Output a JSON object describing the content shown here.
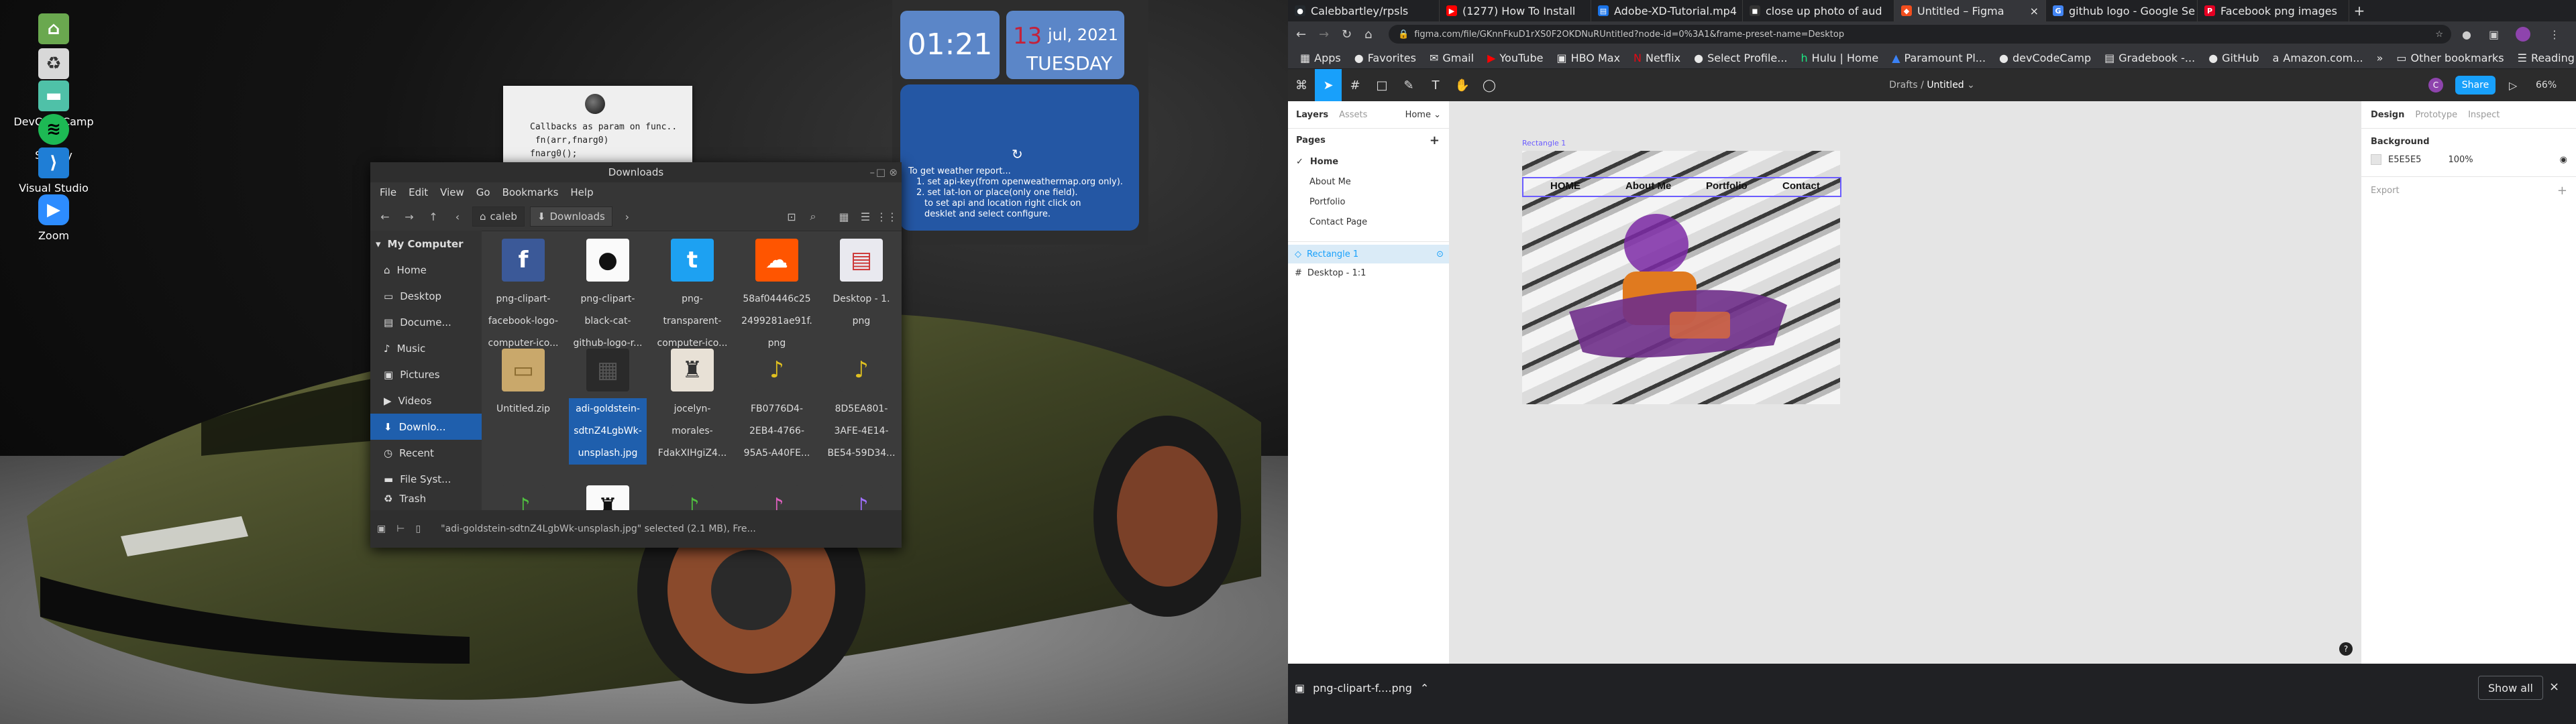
{
  "desktop": {
    "icons": [
      {
        "label": "Home",
        "color": "#6aa84f",
        "glyph": "⌂"
      },
      {
        "label": "Trash",
        "color": "#d8d8d8",
        "glyph": "♻"
      },
      {
        "label": "DevCodeCamp",
        "color": "#4fc1a8",
        "glyph": "▬"
      },
      {
        "label": "Spotify",
        "color": "#1db954",
        "glyph": "≋"
      },
      {
        "label": "Visual Studio Code",
        "color": "#1f7ed6",
        "glyph": "⟩"
      },
      {
        "label": "Zoom",
        "color": "#2d8cff",
        "glyph": "▶"
      }
    ],
    "sticky_note": "Callbacks as param on func..\n fn(arr,fnarg0)\nfnarg0();"
  },
  "clock": {
    "time": "01:21",
    "day": "13",
    "month_year": "jul, 2021",
    "weekday": "TUESDAY",
    "weather_lines": [
      "To get weather report...",
      "1. set api-key(from openweathermap.org only).",
      "2. set lat-lon or place(only one field).",
      "to set api and location right click on",
      "desklet and select configure."
    ]
  },
  "file_manager": {
    "title": "Downloads",
    "menu": [
      "File",
      "Edit",
      "View",
      "Go",
      "Bookmarks",
      "Help"
    ],
    "crumbs": [
      "caleb",
      "Downloads"
    ],
    "sidebar": {
      "header": "My Computer",
      "items": [
        "Home",
        "Desktop",
        "Docume...",
        "Music",
        "Pictures",
        "Videos",
        "Downlo...",
        "Recent",
        "File Syst...",
        "Trash"
      ]
    },
    "files": [
      {
        "name": "png-clipart-facebook-logo-computer-ico...",
        "color": "#3b5998",
        "glyph": "f"
      },
      {
        "name": "png-clipart-black-cat-github-logo-r...",
        "color": "#fafafa",
        "glyph": "●"
      },
      {
        "name": "png-transparent-computer-ico...",
        "color": "#1da1f2",
        "glyph": "t"
      },
      {
        "name": "58af04446c25 2499281ae91f. png",
        "color": "#ff5500",
        "glyph": "☁"
      },
      {
        "name": "Desktop - 1. png",
        "color": "#e9e9ef",
        "glyph": "▤"
      },
      {
        "name": "Untitled.zip",
        "color": "#c9a86b",
        "glyph": "▭"
      },
      {
        "name": "adi-goldstein-sdtnZ4LgbWk-unsplash.jpg",
        "color": "#2a2a2a",
        "glyph": "▦"
      },
      {
        "name": "jocelyn-morales-FdakXIHgiZ4...",
        "color": "#e8e1d6",
        "glyph": "♜"
      },
      {
        "name": "FB0776D4-2EB4-4766-95A5-A40FE...",
        "color": "#3b3b3b",
        "glyph": "♪"
      },
      {
        "name": "8D5EA801-3AFE-4E14-BE54-59D34...",
        "color": "#3b3b3b",
        "glyph": "♪"
      }
    ],
    "status": "\"adi-goldstein-sdtnZ4LgbWk-unsplash.jpg\" selected (2.1 MB), Fre..."
  },
  "chrome": {
    "tabs": [
      {
        "title": "Calebbartley/rpsls",
        "color": "#24292e",
        "glyph": "●"
      },
      {
        "title": "(1277) How To Install",
        "color": "#ff0000",
        "glyph": "▶"
      },
      {
        "title": "Adobe-XD-Tutorial.mp4",
        "color": "#1a73e8",
        "glyph": "▤"
      },
      {
        "title": "close up photo of aud",
        "color": "#333",
        "glyph": "◼"
      },
      {
        "title": "Untitled – Figma",
        "color": "#f24e1e",
        "glyph": "◆"
      },
      {
        "title": "github logo - Google Se",
        "color": "#4285f4",
        "glyph": "G"
      },
      {
        "title": "Facebook png images",
        "color": "#e60023",
        "glyph": "P"
      }
    ],
    "url": "figma.com/file/GKnnFkuD1rXS0F2OKDNuRUntitled?node-id=0%3A1&frame-preset-name=Desktop",
    "bookmarks": [
      "Apps",
      "Favorites",
      "Gmail",
      "YouTube",
      "HBO Max",
      "Netflix",
      "Select Profile...",
      "Hulu | Home",
      "Paramount Pl...",
      "devCodeCamp",
      "Gradebook -...",
      "GitHub",
      "Amazon.com..."
    ],
    "other_bookmarks": "Other bookmarks",
    "reading_list": "Reading list",
    "download": "png-clipart-f....png",
    "show_all": "Show all"
  },
  "figma": {
    "breadcrumb_parent": "Drafts",
    "breadcrumb_file": "Untitled",
    "share": "Share",
    "zoom": "66%",
    "left_tabs": [
      "Layers",
      "Assets"
    ],
    "page_selector": "Home",
    "pages_header": "Pages",
    "pages": [
      "Home",
      "About Me",
      "Portfolio",
      "Contact Page"
    ],
    "layers": [
      "Rectangle 1",
      "Desktop - 1:1"
    ],
    "right_tabs": [
      "Design",
      "Prototype",
      "Inspect"
    ],
    "background_header": "Background",
    "bg_hex": "E5E5E5",
    "bg_opacity": "100%",
    "export": "Export",
    "frame_label": "Rectangle 1",
    "nav": [
      "HOME",
      "About Me",
      "Portfolio",
      "Contact"
    ]
  }
}
